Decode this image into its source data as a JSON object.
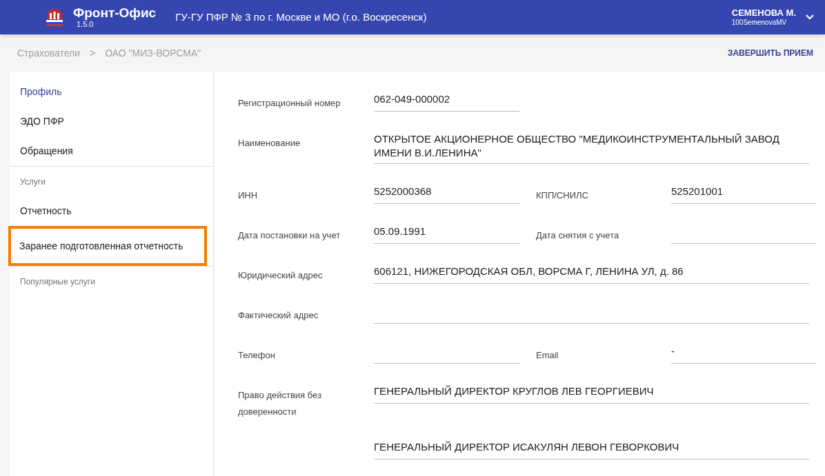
{
  "header": {
    "app_name": "Фронт-Офис",
    "version": "1.5.0",
    "office": "ГУ-ГУ ПФР № 3 по г. Москве и МО (г.о. Воскресенск)",
    "user_name": "СЕМЕНОВА М.",
    "user_login": "100SemenovaMV"
  },
  "breadcrumbs": [
    "Страхователи",
    "ОАО \"МИЗ-ВОРСМА\""
  ],
  "breadcrumb_separator": ">",
  "finish_button": "ЗАВЕРШИТЬ ПРИЕМ",
  "sidebar": {
    "items": [
      {
        "kind": "item",
        "label": "Профиль",
        "selected": true,
        "highlighted": false
      },
      {
        "kind": "item",
        "label": "ЭДО ПФР",
        "selected": false,
        "highlighted": false
      },
      {
        "kind": "item",
        "label": "Обращения",
        "selected": false,
        "highlighted": false
      },
      {
        "kind": "header",
        "label": "Услуги"
      },
      {
        "kind": "item",
        "label": "Отчетность",
        "selected": false,
        "highlighted": false
      },
      {
        "kind": "item",
        "label": "Заранее подготовленная отчетность",
        "selected": false,
        "highlighted": true
      },
      {
        "kind": "header",
        "label": "Популярные услуги"
      }
    ]
  },
  "form": {
    "rows": [
      {
        "fields": [
          {
            "label": "Регистрационный номер",
            "value": "062-049-000002"
          }
        ],
        "kind": "half"
      },
      {
        "fields": [
          {
            "label": "Наименование",
            "value": "ОТКРЫТОЕ АКЦИОНЕРНОЕ ОБЩЕСТВО \"МЕДИКОИНСТРУМЕНТАЛЬНЫЙ ЗАВОД ИМЕНИ В.И.ЛЕНИНА\""
          }
        ],
        "kind": "full"
      },
      {
        "fields": [
          {
            "label": "ИНН",
            "value": "5252000368"
          },
          {
            "label": "КПП/СНИЛС",
            "value": "525201001"
          }
        ],
        "kind": "half"
      },
      {
        "fields": [
          {
            "label": "Дата постановки на учет",
            "value": "05.09.1991"
          },
          {
            "label": "Дата снятия с учета"
          }
        ],
        "kind": "half"
      },
      {
        "fields": [
          {
            "label": "Юридический адрес",
            "value": "606121, НИЖЕГОРОДСКАЯ ОБЛ, ВОРСМА Г, ЛЕНИНА УЛ, д. 86"
          }
        ],
        "kind": "full"
      },
      {
        "fields": [
          {
            "label": "Фактический адрес"
          }
        ],
        "kind": "full"
      },
      {
        "fields": [
          {
            "label": "Телефон"
          },
          {
            "label": "Email",
            "value": "-"
          }
        ],
        "kind": "half"
      },
      {
        "fields": [
          {
            "label": "Право действия без доверенности",
            "value": "ГЕНЕРАЛЬНЫЙ ДИРЕКТОР КРУГЛОВ ЛЕВ ГЕОРГИЕВИЧ"
          }
        ],
        "kind": "full"
      },
      {
        "fields": [
          {
            "value": "ГЕНЕРАЛЬНЫЙ ДИРЕКТОР ИСАКУЛЯН ЛЕВОН ГЕВОРКОВИЧ"
          }
        ],
        "kind": "full"
      }
    ]
  }
}
